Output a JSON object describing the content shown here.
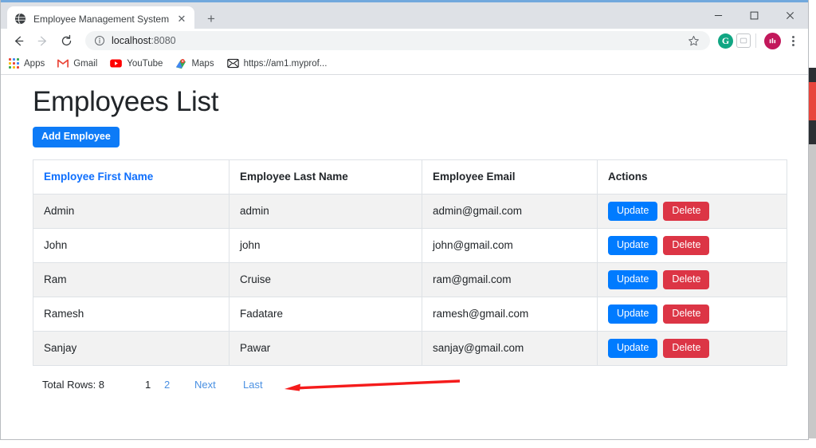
{
  "browser": {
    "tab": {
      "title": "Employee Management System",
      "favicon": "globe-icon",
      "close_label": "✕"
    },
    "new_tab_label": "+",
    "window_controls": {
      "minimize": "—",
      "maximize": "❐",
      "close": "✕"
    },
    "toolbar": {
      "back_label": "←",
      "forward_label": "→",
      "reload_label": "↻",
      "url_host": "localhost",
      "url_port": ":8080",
      "star_label": "☆",
      "grammarly_label": "G",
      "menu_label": "kebab-menu"
    },
    "bookmarks": [
      {
        "label": "Apps",
        "icon": "apps-grid-icon"
      },
      {
        "label": "Gmail",
        "icon": "gmail-icon"
      },
      {
        "label": "YouTube",
        "icon": "youtube-icon"
      },
      {
        "label": "Maps",
        "icon": "maps-pin-icon"
      },
      {
        "label": "https://am1.myprof...",
        "icon": "envelope-icon"
      }
    ]
  },
  "page": {
    "title": "Employees List",
    "add_button": "Add Employee",
    "table": {
      "columns": [
        {
          "label": "Employee First Name",
          "sortable": true
        },
        {
          "label": "Employee Last Name",
          "sortable": false
        },
        {
          "label": "Employee Email",
          "sortable": false
        },
        {
          "label": "Actions",
          "sortable": false
        }
      ],
      "rows": [
        {
          "first_name": "Admin",
          "last_name": "admin",
          "email": "admin@gmail.com",
          "update_label": "Update",
          "delete_label": "Delete"
        },
        {
          "first_name": "John",
          "last_name": "john",
          "email": "john@gmail.com",
          "update_label": "Update",
          "delete_label": "Delete"
        },
        {
          "first_name": "Ram",
          "last_name": "Cruise",
          "email": "ram@gmail.com",
          "update_label": "Update",
          "delete_label": "Delete"
        },
        {
          "first_name": "Ramesh",
          "last_name": "Fadatare",
          "email": "ramesh@gmail.com",
          "update_label": "Update",
          "delete_label": "Delete"
        },
        {
          "first_name": "Sanjay",
          "last_name": "Pawar",
          "email": "sanjay@gmail.com",
          "update_label": "Update",
          "delete_label": "Delete"
        }
      ]
    },
    "pagination": {
      "total_rows_label": "Total Rows: 8",
      "page_1": "1",
      "page_2": "2",
      "next": "Next",
      "last": "Last"
    },
    "annotation": {
      "type": "red-left-arrow",
      "color": "#f51b1b"
    }
  },
  "colors": {
    "primary_blue": "#007bff",
    "add_blue": "#0d7bf7",
    "link_blue": "#4a90e2",
    "danger_red": "#dc3545",
    "annotation_red": "#f51b1b",
    "row_alt": "#f2f2f2",
    "border": "#dee2e6"
  }
}
